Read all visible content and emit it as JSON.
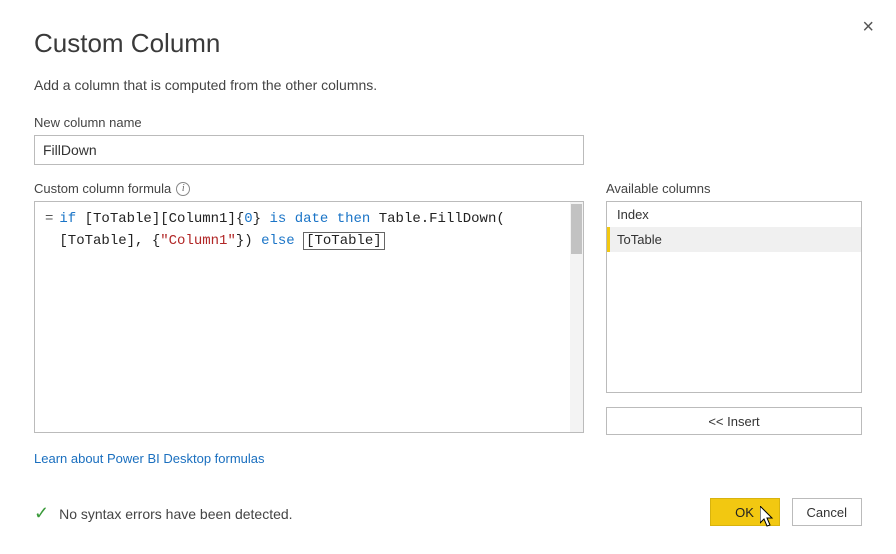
{
  "header": {
    "title": "Custom Column",
    "subtitle": "Add a column that is computed from the other columns."
  },
  "name_field": {
    "label": "New column name",
    "value": "FillDown"
  },
  "formula_field": {
    "label": "Custom column formula",
    "tokens": {
      "kw_if": "if",
      "ref1": "[ToTable][Column1]{",
      "num0": "0",
      "close_brace": "}",
      "kw_is": "is",
      "kw_date": "date",
      "kw_then": "then",
      "fn": "Table.FillDown(",
      "line2a": "[ToTable], {",
      "str": "\"Column1\"",
      "line2b": "})",
      "kw_else": "else",
      "boxed": "[ToTable]"
    }
  },
  "available": {
    "label": "Available columns",
    "items": [
      "Index",
      "ToTable"
    ],
    "selected_index": 1,
    "insert_label": "<< Insert"
  },
  "link_text": "Learn about Power BI Desktop formulas",
  "status": {
    "message": "No syntax errors have been detected."
  },
  "buttons": {
    "ok": "OK",
    "cancel": "Cancel"
  }
}
